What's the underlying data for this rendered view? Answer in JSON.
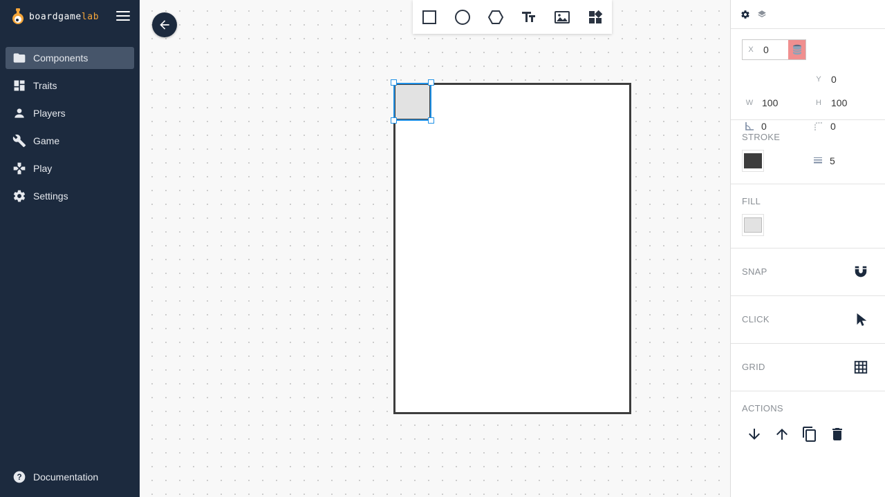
{
  "brand": {
    "name_main": "boardgame",
    "name_accent": "lab",
    "accent_color": "#f5a63a"
  },
  "nav": {
    "items": [
      {
        "label": "Components",
        "icon": "folder-icon",
        "active": true
      },
      {
        "label": "Traits",
        "icon": "dashboard-icon"
      },
      {
        "label": "Players",
        "icon": "person-icon"
      },
      {
        "label": "Game",
        "icon": "wrench-icon"
      },
      {
        "label": "Play",
        "icon": "gamepad-icon"
      },
      {
        "label": "Settings",
        "icon": "gear-icon"
      }
    ],
    "documentation": "Documentation"
  },
  "toolbar": {
    "tools": [
      "rectangle-tool-icon",
      "circle-tool-icon",
      "hexagon-tool-icon",
      "text-tool-icon",
      "image-tool-icon",
      "widgets-tool-icon"
    ]
  },
  "canvas": {
    "selection_color": "#1e90e6",
    "card_stroke": "#3d3d3d",
    "shape_fill": "#e2e2e2"
  },
  "panel": {
    "geometry": {
      "x_label": "X",
      "x_value": "0",
      "y_label": "Y",
      "y_value": "0",
      "w_label": "W",
      "w_value": "100",
      "h_label": "H",
      "h_value": "100",
      "angle_value": "0",
      "radius_value": "0"
    },
    "stroke": {
      "title": "STROKE",
      "color": "#3d3d3d",
      "width": "5"
    },
    "fill": {
      "title": "FILL",
      "color": "#e2e2e2"
    },
    "snap": {
      "title": "SNAP"
    },
    "click": {
      "title": "CLICK"
    },
    "grid": {
      "title": "GRID"
    },
    "actions": {
      "title": "ACTIONS"
    }
  }
}
